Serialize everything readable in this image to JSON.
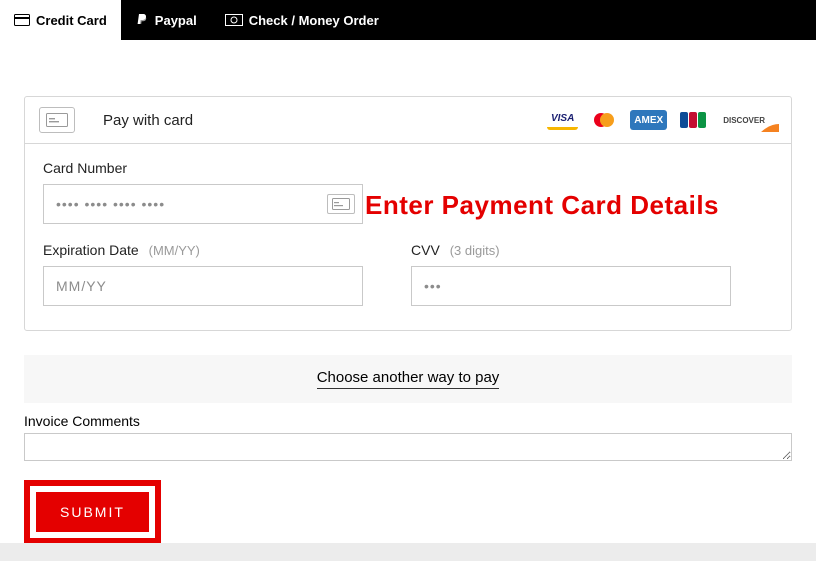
{
  "tabs": [
    {
      "label": "Credit Card",
      "icon": "credit-card-icon"
    },
    {
      "label": "Paypal",
      "icon": "paypal-icon"
    },
    {
      "label": "Check / Money Order",
      "icon": "money-icon"
    }
  ],
  "pay_header": "Pay with card",
  "brands": [
    "VISA",
    "mastercard",
    "AMEX",
    "JCB",
    "DISCOVER"
  ],
  "card_number": {
    "label": "Card Number",
    "placeholder": "•••• •••• •••• ••••"
  },
  "expiration": {
    "label": "Expiration Date",
    "hint": "(MM/YY)",
    "placeholder": "MM/YY"
  },
  "cvv": {
    "label": "CVV",
    "hint": "(3 digits)",
    "placeholder": "•••"
  },
  "annotation": "Enter Payment Card Details",
  "alt_pay": "Choose another way to pay",
  "comments_label": "Invoice Comments",
  "submit_label": "SUBMIT"
}
